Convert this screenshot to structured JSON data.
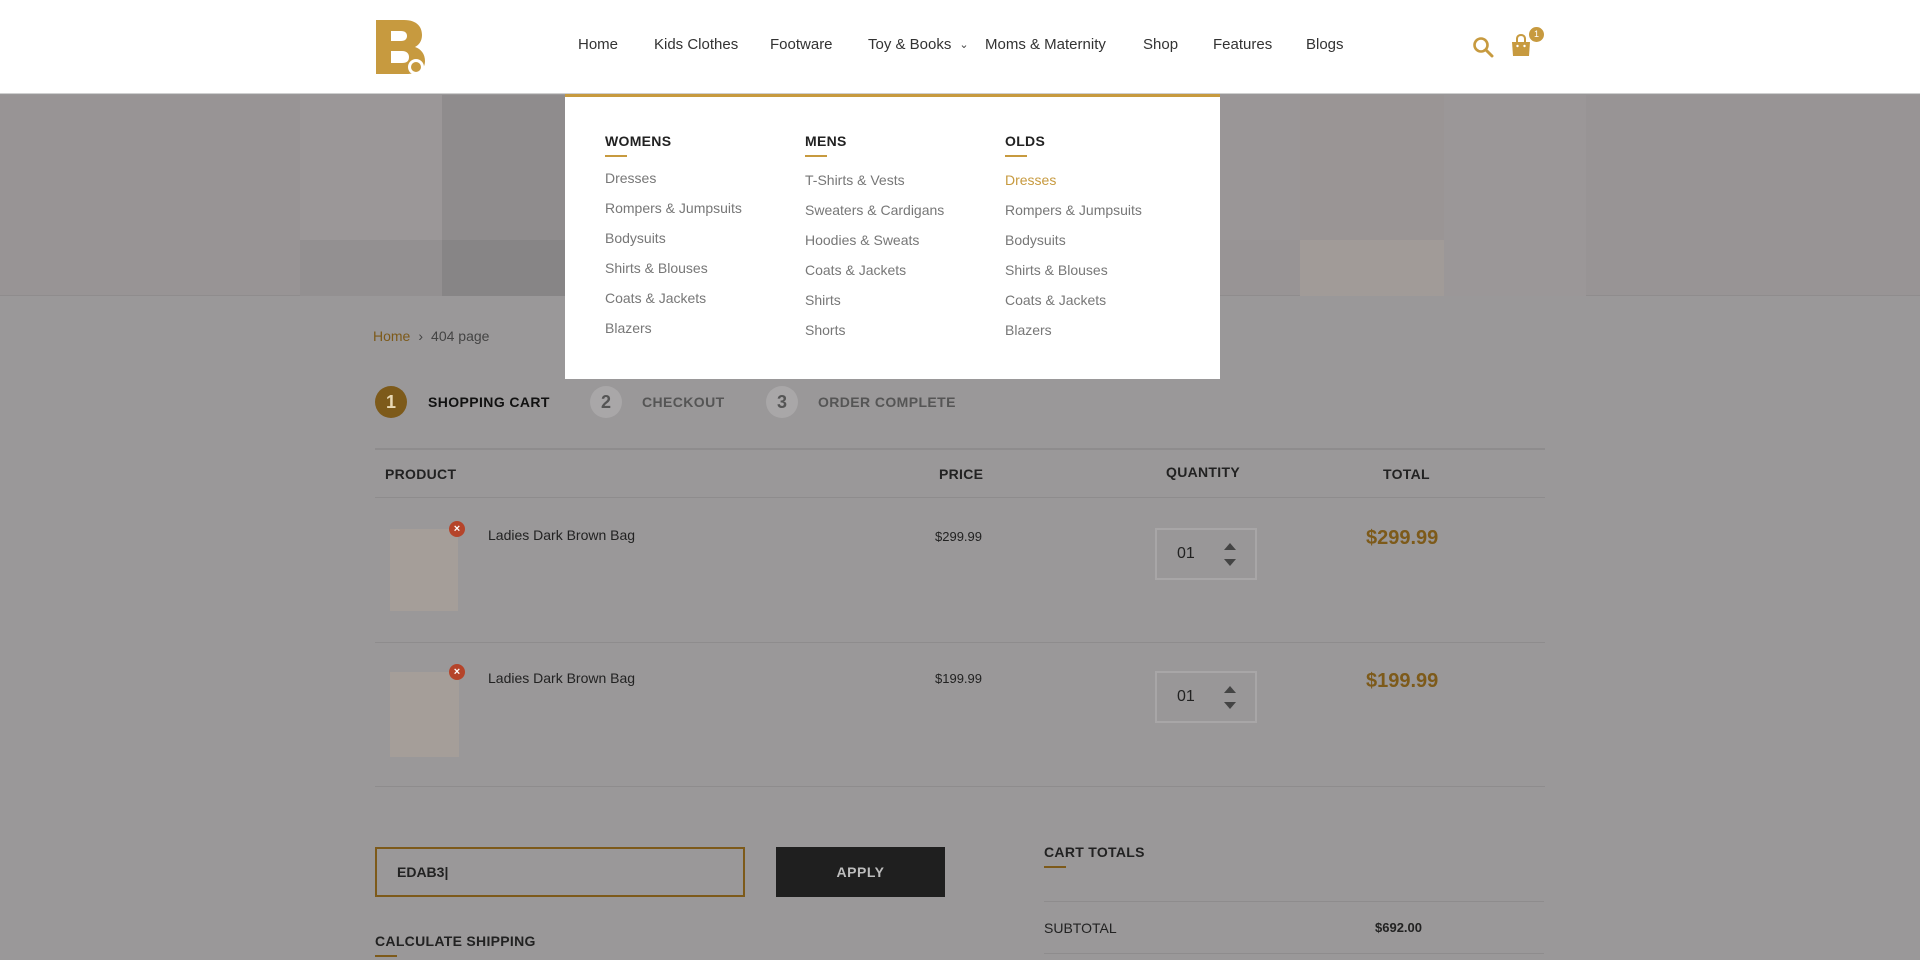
{
  "header": {
    "logo_letter": "B",
    "nav": [
      {
        "label": "Home",
        "has_dropdown": false
      },
      {
        "label": "Kids Clothes",
        "has_dropdown": false
      },
      {
        "label": "Footware",
        "has_dropdown": false
      },
      {
        "label": "Toy & Books",
        "has_dropdown": true
      },
      {
        "label": "Moms & Maternity",
        "has_dropdown": false
      },
      {
        "label": "Shop",
        "has_dropdown": false
      },
      {
        "label": "Features",
        "has_dropdown": false
      },
      {
        "label": "Blogs",
        "has_dropdown": false
      }
    ],
    "search_icon": "search-icon",
    "cart_icon": "shopping-bag-icon",
    "cart_count": "1"
  },
  "mega_menu": {
    "columns": [
      {
        "heading": "WOMENS",
        "links": [
          "Dresses",
          "Rompers & Jumpsuits",
          "Bodysuits",
          "Shirts & Blouses",
          "Coats & Jackets",
          "Blazers"
        ]
      },
      {
        "heading": "MENS",
        "links": [
          "T-Shirts & Vests",
          "Sweaters & Cardigans",
          "Hoodies & Sweats",
          "Coats & Jackets",
          "Shirts",
          "Shorts"
        ]
      },
      {
        "heading": "OLDS",
        "links": [
          "Dresses",
          "Rompers & Jumpsuits",
          "Bodysuits",
          "Shirts & Blouses",
          "Coats & Jackets",
          "Blazers"
        ],
        "active_index": 0
      }
    ]
  },
  "breadcrumb": {
    "home": "Home",
    "separator": "›",
    "current": "404 page"
  },
  "steps": [
    {
      "number": "1",
      "label": "SHOPPING CART",
      "active": true
    },
    {
      "number": "2",
      "label": "CHECKOUT",
      "active": false
    },
    {
      "number": "3",
      "label": "ORDER COMPLETE",
      "active": false
    }
  ],
  "cart_table": {
    "headers": {
      "product": "PRODUCT",
      "price": "PRICE",
      "quantity": "QUANTITY",
      "total": "TOTAL"
    },
    "rows": [
      {
        "name": "Ladies Dark Brown Bag",
        "price": "$299.99",
        "quantity": "01",
        "total": "$299.99"
      },
      {
        "name": "Ladies Dark Brown Bag",
        "price": "$199.99",
        "quantity": "01",
        "total": "$199.99"
      }
    ],
    "remove_icon": "remove-icon"
  },
  "coupon": {
    "value": "EDAB3|",
    "apply_label": "APPLY"
  },
  "shipping": {
    "title": "CALCULATE SHIPPING"
  },
  "totals": {
    "title": "CART TOTALS",
    "subtotal_label": "SUBTOTAL",
    "subtotal_value": "$692.00"
  },
  "colors": {
    "accent": "#c79a3f",
    "accent_dark": "#7d5a1a",
    "overlay": "#9a9899",
    "button": "#1f1f1f"
  }
}
